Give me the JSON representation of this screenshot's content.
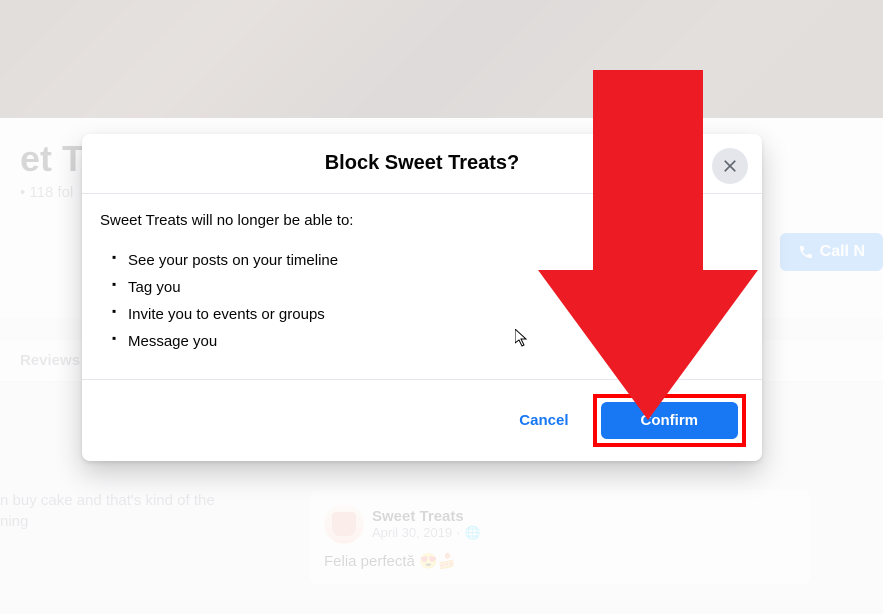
{
  "page": {
    "title": "et Tr",
    "meta": "• 118 fol"
  },
  "tabs": {
    "reviews": "Reviews"
  },
  "callButton": {
    "label": "Call N"
  },
  "leftCard": {
    "line1": "n buy cake and that's kind of the",
    "line2": "ning"
  },
  "post": {
    "author": "Sweet Treats",
    "date": "April 30, 2019",
    "visibility": "🌐",
    "text": "Felia perfectă 😍🍰"
  },
  "modal": {
    "title": "Block Sweet Treats?",
    "intro": "Sweet Treats will no longer be able to:",
    "items": [
      "See your posts on your timeline",
      "Tag you",
      "Invite you to events or groups",
      "Message you"
    ],
    "cancel": "Cancel",
    "confirm": "Confirm"
  }
}
